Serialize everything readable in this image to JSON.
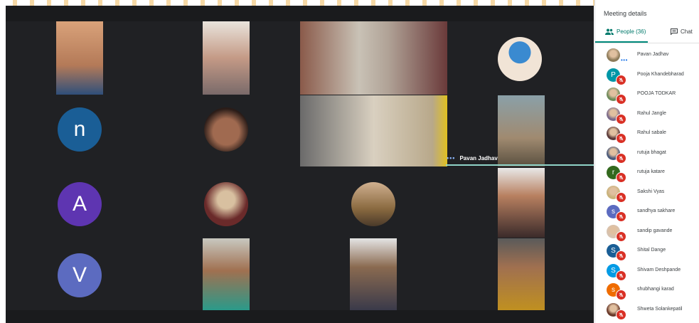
{
  "panel": {
    "title": "Meeting details",
    "tab_people": "People (36)",
    "tab_chat": "Chat"
  },
  "stage": {
    "pinned_name": "Pavan Jadhav",
    "avatars": [
      {
        "letter": "n",
        "color": "#1a5e96"
      },
      {
        "letter": "A",
        "color": "#5e35b1"
      },
      {
        "letter": "V",
        "color": "#5c6bc0"
      }
    ]
  },
  "people": [
    {
      "name": "Pavan Jadhav",
      "initial": "",
      "color": "#8d7b5a",
      "muted": false,
      "photo": true
    },
    {
      "name": "Pooja Khandebharad",
      "initial": "P",
      "color": "#0097a7",
      "muted": true,
      "photo": false
    },
    {
      "name": "POOJA TODKAR",
      "initial": "",
      "color": "#6d8a5a",
      "muted": true,
      "photo": true
    },
    {
      "name": "Rahul Jangle",
      "initial": "",
      "color": "#7a6a8a",
      "muted": true,
      "photo": true
    },
    {
      "name": "Rahul sabale",
      "initial": "",
      "color": "#5a3a3a",
      "muted": true,
      "photo": true
    },
    {
      "name": "rutuja bhagat",
      "initial": "",
      "color": "#4a5a7a",
      "muted": true,
      "photo": true
    },
    {
      "name": "rutuja katare",
      "initial": "r",
      "color": "#33691e",
      "muted": true,
      "photo": false
    },
    {
      "name": "Sakshi Vyas",
      "initial": "",
      "color": "#c8b27a",
      "muted": true,
      "photo": true
    },
    {
      "name": "sandhya sakhare",
      "initial": "s",
      "color": "#5c6bc0",
      "muted": true,
      "photo": false
    },
    {
      "name": "sandip gavande",
      "initial": "",
      "color": "#d6c2b0",
      "muted": true,
      "photo": true
    },
    {
      "name": "Shital Dange",
      "initial": "S",
      "color": "#1a5e96",
      "muted": true,
      "photo": false
    },
    {
      "name": "Shivam Deshpande",
      "initial": "S",
      "color": "#039be5",
      "muted": true,
      "photo": false
    },
    {
      "name": "shubhangi karad",
      "initial": "s",
      "color": "#ef6c00",
      "muted": true,
      "photo": false
    },
    {
      "name": "Shweta Solankepatil",
      "initial": "",
      "color": "#6a3a2a",
      "muted": true,
      "photo": true
    }
  ]
}
